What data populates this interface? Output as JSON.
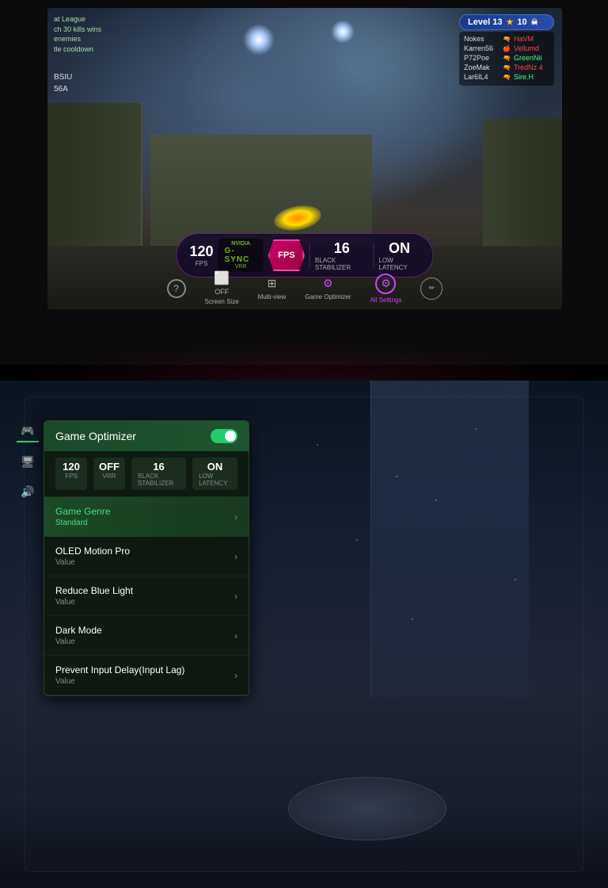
{
  "top": {
    "game_scene": "FPS game - urban map",
    "level_badge": "Level 13",
    "star_count": "10",
    "skull_icon": "☠",
    "players": [
      {
        "name": "Nokes",
        "weapon": "🔫",
        "team": "red",
        "score": "HaVM"
      },
      {
        "name": "Karren56",
        "weapon": "🍎",
        "team": "red",
        "score": "Vellumd"
      },
      {
        "name": "P72Poe",
        "weapon": "🔫",
        "team": "green",
        "score": "GreenNii"
      },
      {
        "name": "ZoeMak",
        "weapon": "🔫",
        "team": "red",
        "score": "TredNz 4"
      },
      {
        "name": "Lar6IL4",
        "weapon": "🔫",
        "team": "green",
        "score": "Sire.H"
      }
    ],
    "hud_left": "at League\nch 30 kills wins\nenemies\ntle cooldown",
    "hud_score": "BSIU\n56A",
    "fps_value": "120",
    "fps_label": "FPS",
    "gsync_brand": "NVIDIA",
    "gsync_text": "G-SYNC",
    "gsync_sub": "VRR",
    "fps_mode": "FPS",
    "black_stabilizer_value": "16",
    "black_stabilizer_label": "Black Stabilizer",
    "low_latency_value": "ON",
    "low_latency_label": "Low Latency",
    "toolbar": {
      "help": "?",
      "screen_size_label": "Screen Size",
      "screen_size_state": "OFF",
      "multiview_label": "Multi-view",
      "optimizer_label": "Game Optimizer",
      "all_settings_label": "All Settings",
      "edit_icon": "✏"
    }
  },
  "bottom": {
    "game_scene": "Fantasy/Sci-fi frozen map",
    "panel": {
      "title": "Game Optimizer",
      "toggle_on": true,
      "stats": [
        {
          "value": "120",
          "label": "FPS"
        },
        {
          "value": "OFF",
          "label": "VRR"
        },
        {
          "value": "16",
          "label": "Black Stabilizer"
        },
        {
          "value": "ON",
          "label": "Low Latency"
        }
      ],
      "menu_items": [
        {
          "title": "Game Genre",
          "title_color": "green",
          "value": "Standard",
          "value_color": "green",
          "highlighted": true
        },
        {
          "title": "OLED Motion Pro",
          "value": "Value",
          "highlighted": false
        },
        {
          "title": "Reduce Blue Light",
          "value": "Value",
          "highlighted": false
        },
        {
          "title": "Dark Mode",
          "value": "Value",
          "highlighted": false
        },
        {
          "title": "Prevent Input Delay(Input Lag)",
          "value": "Value",
          "highlighted": false
        }
      ]
    },
    "sidebar_icons": [
      {
        "label": "gamepad",
        "symbol": "🎮",
        "active": true
      },
      {
        "label": "display",
        "symbol": "🖥",
        "active": false
      },
      {
        "label": "sound",
        "symbol": "🔊",
        "active": false
      }
    ]
  }
}
